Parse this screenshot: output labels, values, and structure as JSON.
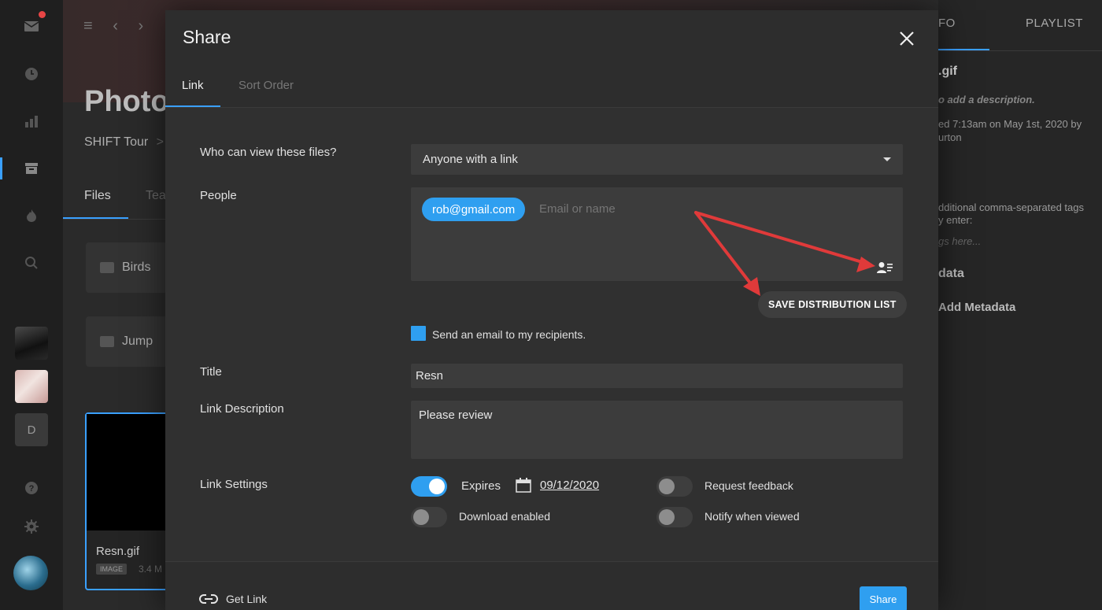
{
  "background": {
    "page_title": "Photo",
    "breadcrumb": "SHIFT Tour",
    "breadcrumb_sep": ">",
    "tabs": [
      "Files",
      "Tea"
    ],
    "folders": [
      "Birds",
      "Jump"
    ],
    "file_card": {
      "name": "Resn.gif",
      "badge": "IMAGE",
      "size": "3.4 M"
    },
    "rail_letter": "D",
    "right_panel": {
      "tabs": [
        "FO",
        "PLAYLIST"
      ],
      "filename": ".gif",
      "description_hint": "o add a description.",
      "uploaded_line1": "ed 7:13am on May 1st, 2020 by",
      "uploaded_line2": "urton",
      "tags_line1": "dditional comma-separated tags",
      "tags_line2": "y enter:",
      "tags_placeholder": "gs here...",
      "metadata_heading": "data",
      "add_metadata": "Add Metadata"
    }
  },
  "modal": {
    "title": "Share",
    "tabs": {
      "link": "Link",
      "sort_order": "Sort Order"
    },
    "labels": {
      "who_can_view": "Who can view these files?",
      "people": "People",
      "title": "Title",
      "link_description": "Link Description",
      "link_settings": "Link Settings"
    },
    "access_select": {
      "value": "Anyone with a link"
    },
    "people": {
      "chip": "rob@gmail.com",
      "placeholder": "Email or name"
    },
    "save_distribution_list": "SAVE DISTRIBUTION LIST",
    "send_email_label": "Send an email to my recipients.",
    "title_value": "Resn",
    "description_value": "Please review",
    "settings": {
      "expires_label": "Expires",
      "expires_on": true,
      "expires_date": "09/12/2020",
      "request_feedback_label": "Request feedback",
      "request_feedback_on": false,
      "download_label": "Download enabled",
      "download_on": false,
      "notify_label": "Notify when viewed",
      "notify_on": false
    },
    "footer": {
      "get_link": "Get Link",
      "share": "Share"
    }
  },
  "colors": {
    "accent": "#2f9ff0",
    "annotation_arrow": "#e03a3a"
  }
}
